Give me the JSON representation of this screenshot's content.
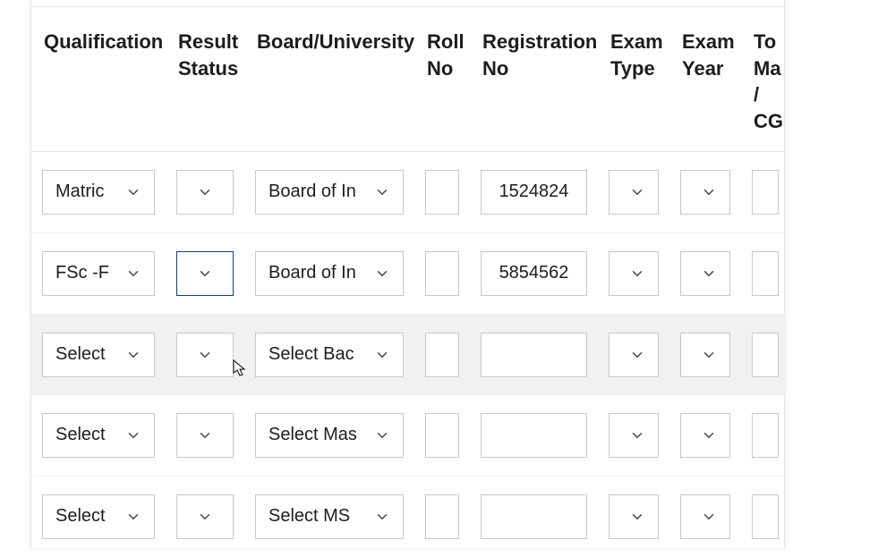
{
  "headers": {
    "qualification": "Qualification",
    "result_status": "Result Status",
    "board": "Board/University",
    "roll_no": "Roll No",
    "reg_no": "Registration No",
    "exam_type": "Exam Type",
    "exam_year": "Exam Year",
    "total_marks": "To Ma / CG"
  },
  "rows": [
    {
      "qualification": "Matric",
      "result_status": "",
      "board": "Board of In",
      "roll_no": "",
      "reg_no": "1524824",
      "exam_type": "",
      "exam_year": "",
      "total_marks": ""
    },
    {
      "qualification": "FSc -F",
      "result_status": "",
      "board": "Board of In",
      "roll_no": "",
      "reg_no": "5854562",
      "exam_type": "",
      "exam_year": "",
      "total_marks": "",
      "result_status_focused": true
    },
    {
      "qualification": "Select",
      "result_status": "",
      "board": "Select Bac",
      "roll_no": "",
      "reg_no": "",
      "exam_type": "",
      "exam_year": "",
      "total_marks": "",
      "highlight": true
    },
    {
      "qualification": "Select",
      "result_status": "",
      "board": "Select Mas",
      "roll_no": "",
      "reg_no": "",
      "exam_type": "",
      "exam_year": "",
      "total_marks": ""
    },
    {
      "qualification": "Select",
      "result_status": "",
      "board": "Select MS",
      "roll_no": "",
      "reg_no": "",
      "exam_type": "",
      "exam_year": "",
      "total_marks": ""
    }
  ]
}
